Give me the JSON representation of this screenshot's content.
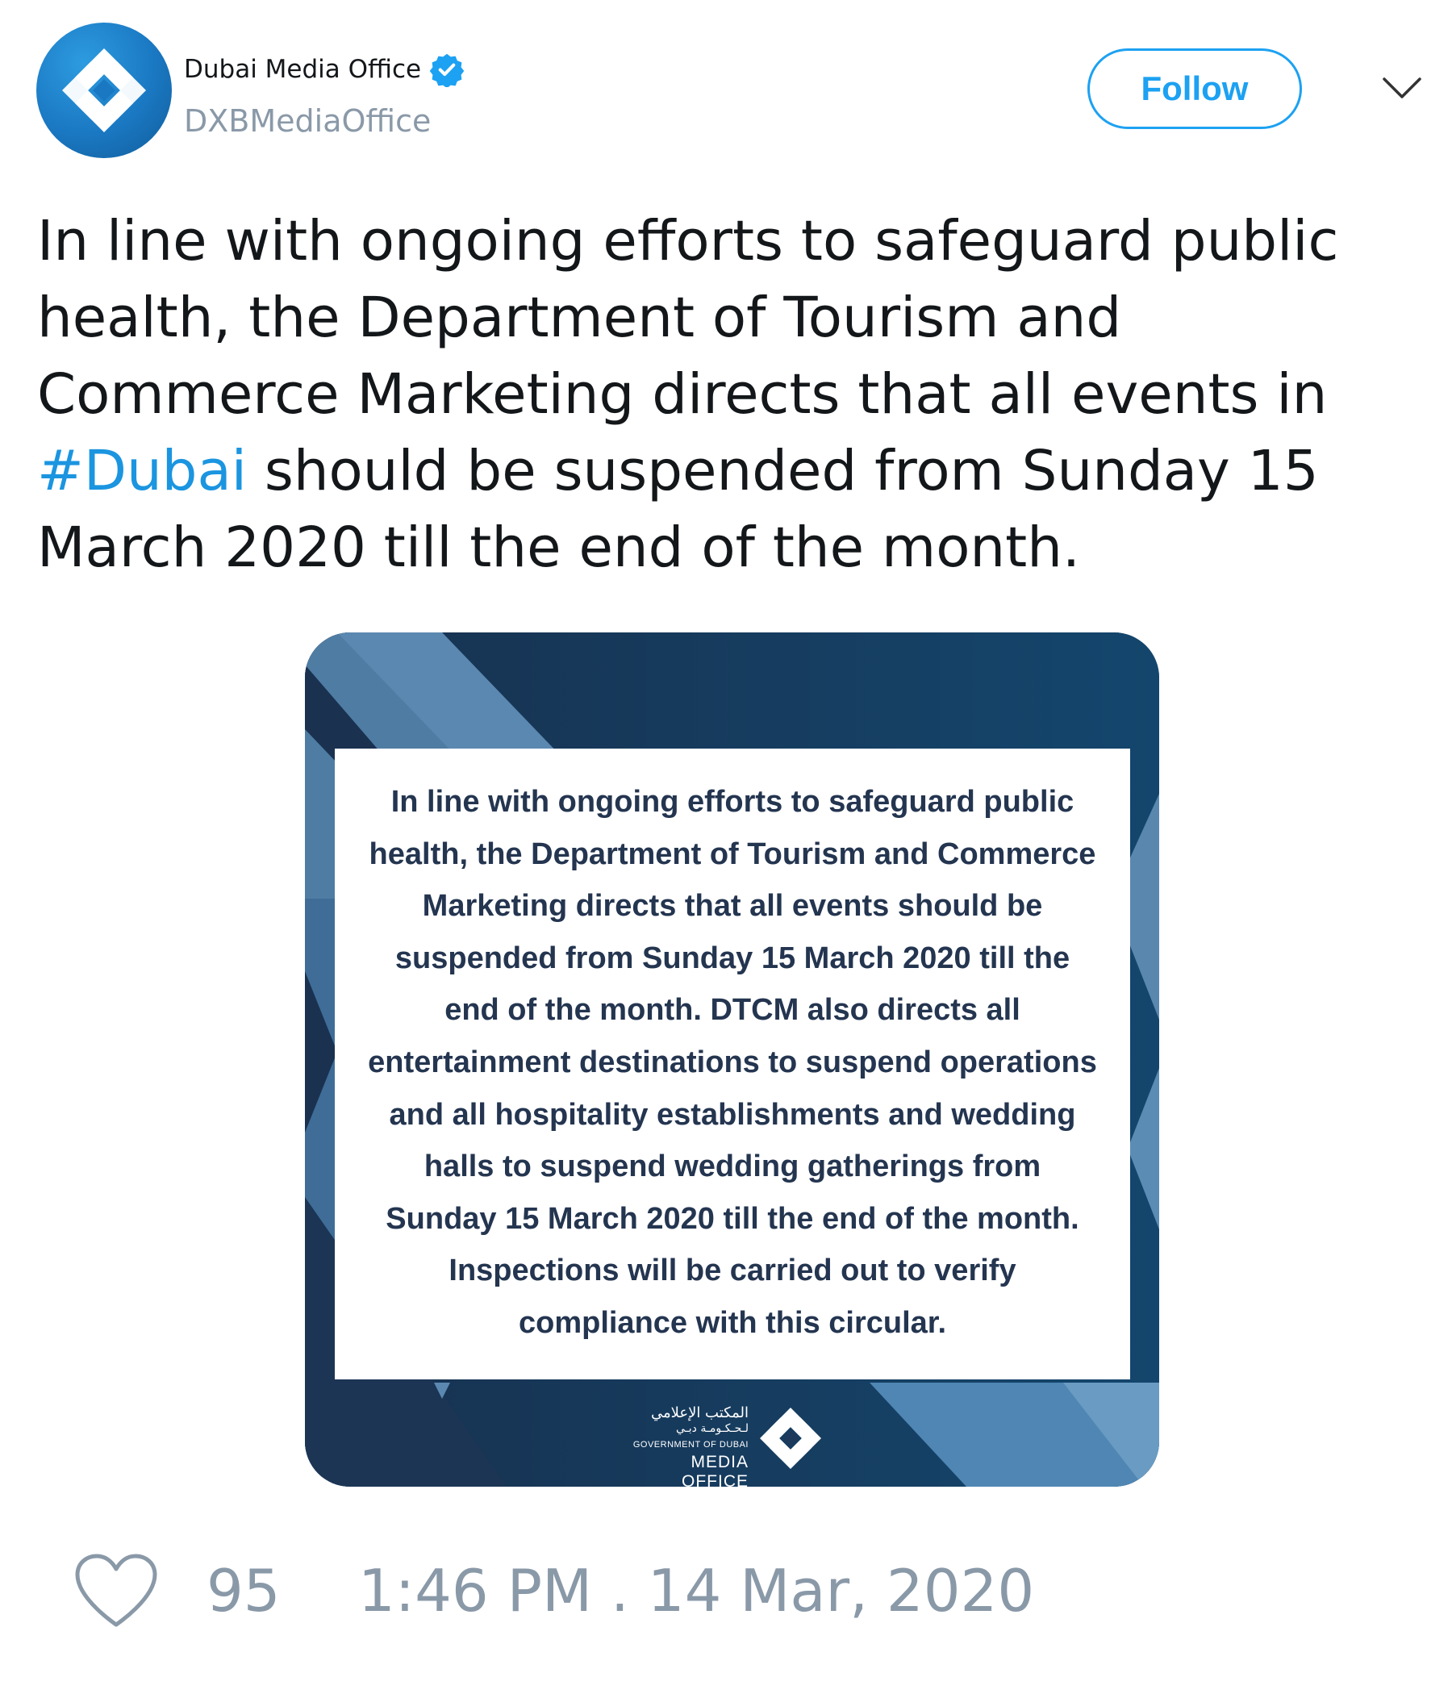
{
  "author": {
    "display_name": "Dubai Media Office",
    "handle": "DXBMediaOffice",
    "verified_icon": "verified-badge-icon",
    "avatar_icon": "dubai-media-office-logo"
  },
  "header": {
    "follow_label": "Follow",
    "menu_icon": "chevron-down-icon"
  },
  "tweet": {
    "line1": "In line with ongoing efforts to safeguard public",
    "line2": "health, the Department of Tourism and",
    "line3": "Commerce Marketing directs that all events in",
    "hashtag": "#Dubai",
    "line4_rest": " should be suspended from Sunday 15",
    "line5": "March 2020 till the end of the month."
  },
  "image_card": {
    "notice_lines": [
      "In line with ongoing efforts to safeguard public",
      "health, the Department of Tourism and Commerce",
      "Marketing directs that all events should be",
      "suspended from Sunday 15 March 2020 till the",
      "end of the month. DTCM also directs all",
      "entertainment destinations to suspend operations",
      "and all hospitality establishments and wedding",
      "halls to suspend wedding gatherings from",
      "Sunday 15 March 2020 till the end of the month.",
      "Inspections will be carried out to verify",
      "compliance with this circular."
    ],
    "logo_arabic_line1": "المكتب الإعلامي",
    "logo_arabic_line2": "لـحـكـومـة دبـي",
    "logo_gov": "GOVERNMENT OF DUBAI",
    "logo_media_office": "MEDIA OFFICE"
  },
  "footer": {
    "like_icon": "heart-icon",
    "like_count": "95",
    "timestamp": "1:46 PM . 14 Mar, 2020"
  },
  "colors": {
    "accent": "#1da1f2",
    "hashtag": "#1b95e0",
    "muted": "#8a99a8",
    "card_dark": "#1d3a5c",
    "notice_text": "#243550"
  }
}
